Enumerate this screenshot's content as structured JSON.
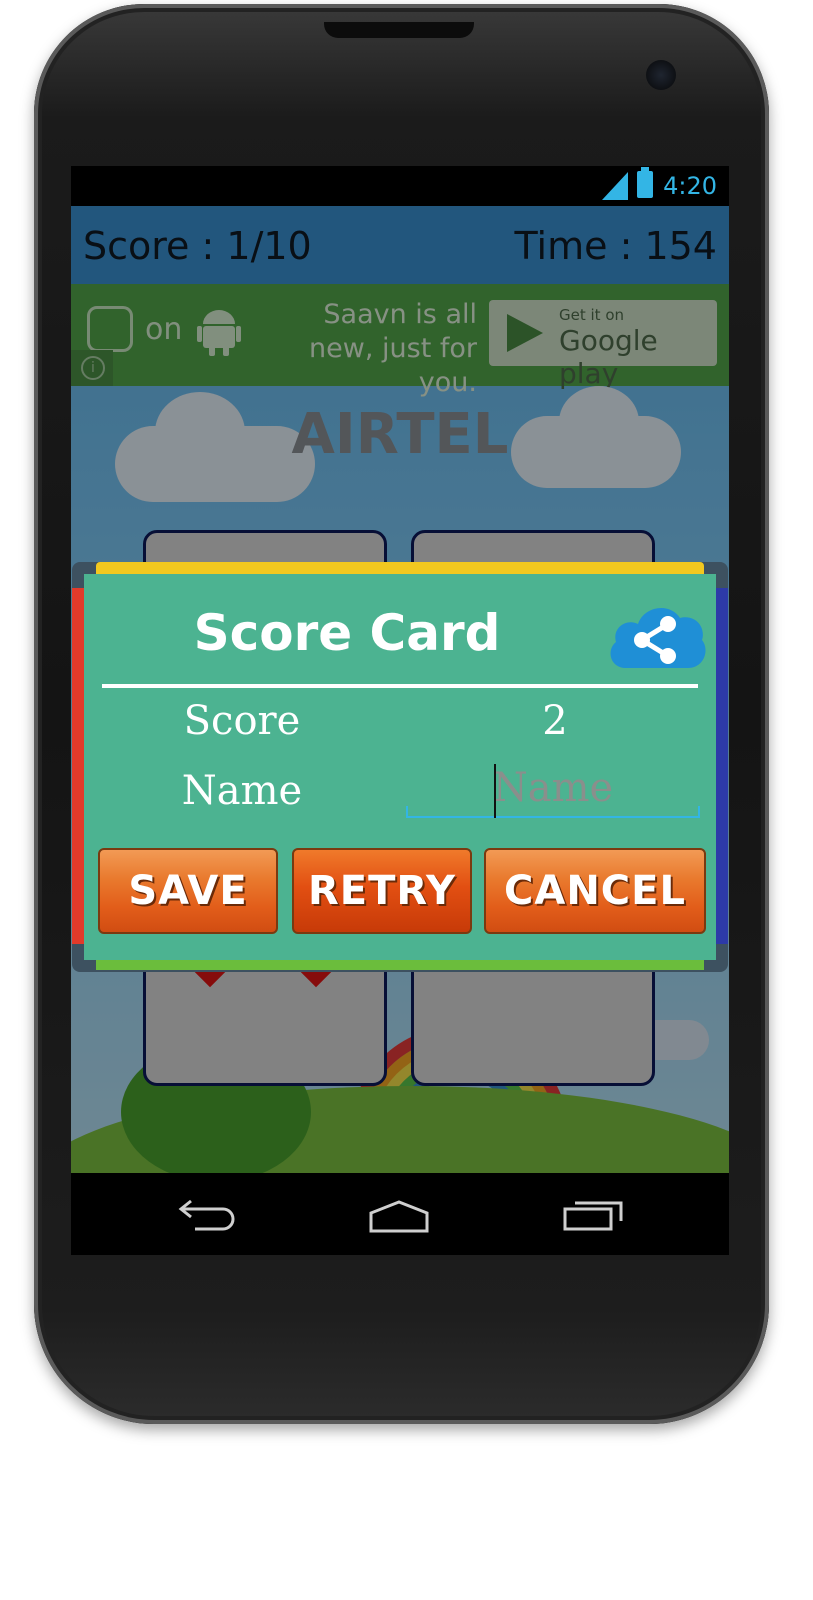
{
  "status_bar": {
    "time": "4:20",
    "signal_icon": "signal-icon",
    "battery_icon": "battery-icon",
    "accent": "#33b5e5"
  },
  "game_header": {
    "score_text": "Score : 1/10",
    "time_text": "Time : 154"
  },
  "ad": {
    "on_text": "on",
    "message": "Saavn is all new, just for you.",
    "play_small": "Get it on",
    "play_big": "Google play"
  },
  "game": {
    "word": "AIRTEL"
  },
  "dialog": {
    "title": "Score Card",
    "score_label": "Score",
    "score_value": "2",
    "name_label": "Name",
    "name_placeholder": "Name",
    "name_value": "",
    "buttons": {
      "save": "SAVE",
      "retry": "RETRY",
      "cancel": "CANCEL"
    },
    "background": "#4cb391"
  },
  "nav": {
    "back_icon": "back-icon",
    "home_icon": "home-icon",
    "recent_icon": "recent-apps-icon"
  }
}
